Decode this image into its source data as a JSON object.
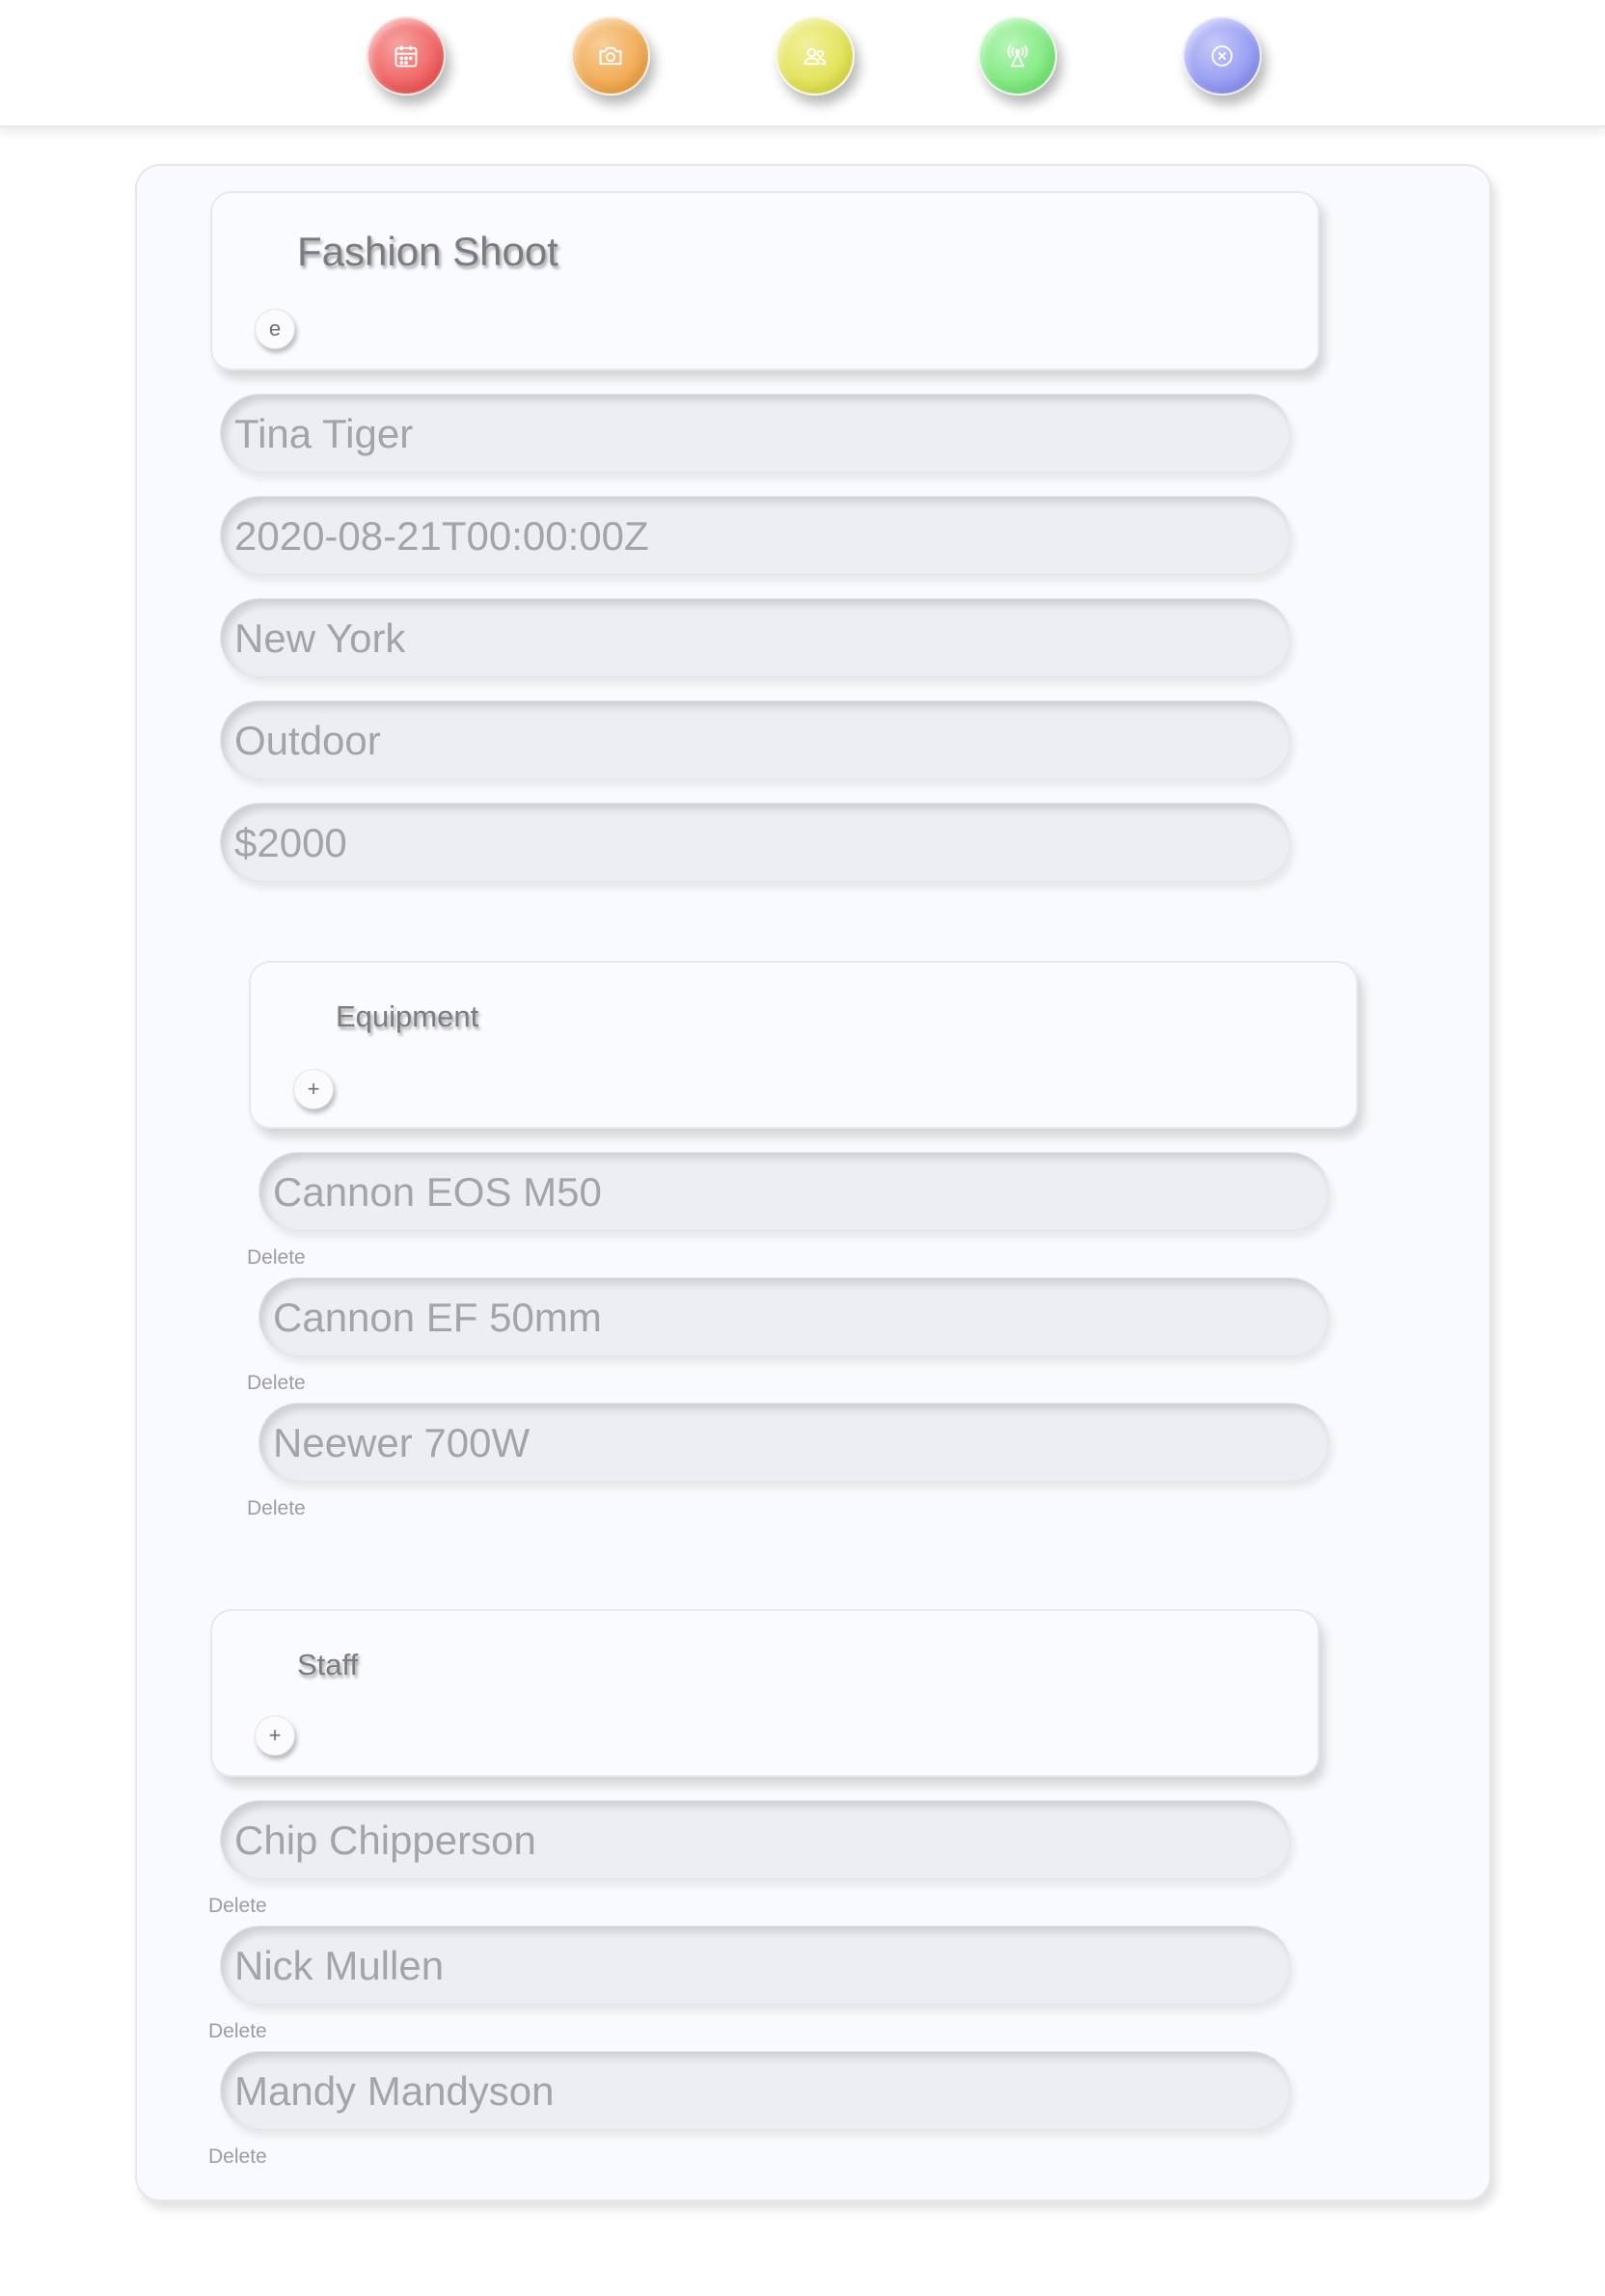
{
  "nav": [
    {
      "icon": "calendar-icon",
      "color": "#ef5a5a",
      "color_light": "#f7a3a3"
    },
    {
      "icon": "camera-icon",
      "color": "#f0a54a",
      "color_light": "#f8cf9a"
    },
    {
      "icon": "users-icon",
      "color": "#e0e04e",
      "color_light": "#f1f19e"
    },
    {
      "icon": "broadcast-icon",
      "color": "#78e878",
      "color_light": "#b9f5b9"
    },
    {
      "icon": "close-circle-icon",
      "color": "#8f95f2",
      "color_light": "#c6c9f8"
    }
  ],
  "shoot": {
    "title": "Fashion Shoot",
    "edit_label": "e",
    "fields": [
      "Tina Tiger",
      "2020-08-21T00:00:00Z",
      "New York",
      "Outdoor",
      "$2000"
    ]
  },
  "equipment": {
    "title": "Equipment",
    "add_label": "+",
    "items": [
      "Cannon EOS M50",
      "Cannon EF 50mm",
      "Neewer 700W"
    ],
    "delete_label": "Delete"
  },
  "staff": {
    "title": "Staff",
    "add_label": "+",
    "items": [
      "Chip Chipperson",
      "Nick Mullen",
      "Mandy Mandyson"
    ],
    "delete_label": "Delete"
  }
}
